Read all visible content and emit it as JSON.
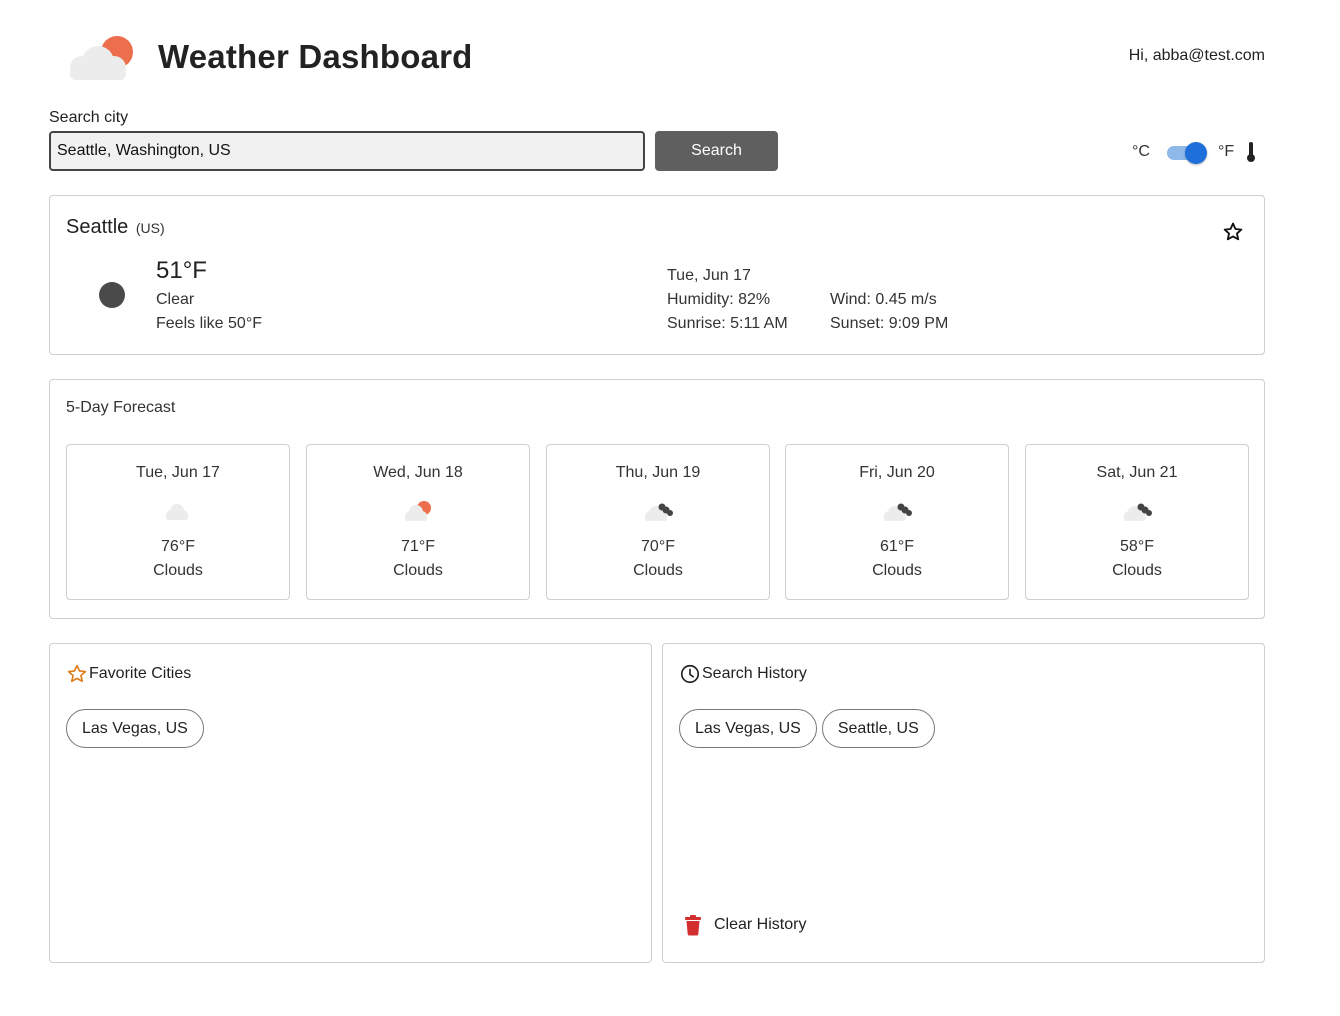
{
  "app": {
    "title": "Weather Dashboard",
    "greeting": "Hi, abba@test.com"
  },
  "search": {
    "label": "Search city",
    "value": "Seattle, Washington, US",
    "button_label": "Search"
  },
  "units": {
    "celsius_label": "°C",
    "fahrenheit_label": "°F",
    "selected": "F"
  },
  "current": {
    "city": "Seattle",
    "country": "(US)",
    "temperature": "51°F",
    "description": "Clear",
    "feels_like": "Feels like 50°F",
    "date": "Tue, Jun 17",
    "humidity": "Humidity: 82%",
    "wind": "Wind: 0.45 m/s",
    "sunrise": "Sunrise: 5:11 AM",
    "sunset": "Sunset: 9:09 PM",
    "icon": "clear-night-icon",
    "icon_color": "#4a4a4a"
  },
  "forecast": {
    "title": "5-Day Forecast",
    "days": [
      {
        "date": "Tue, Jun 17",
        "temp": "76°F",
        "desc": "Clouds",
        "icon": "few-clouds-icon"
      },
      {
        "date": "Wed, Jun 18",
        "temp": "71°F",
        "desc": "Clouds",
        "icon": "partly-cloudy-day-icon"
      },
      {
        "date": "Thu, Jun 19",
        "temp": "70°F",
        "desc": "Clouds",
        "icon": "broken-clouds-icon"
      },
      {
        "date": "Fri, Jun 20",
        "temp": "61°F",
        "desc": "Clouds",
        "icon": "broken-clouds-icon"
      },
      {
        "date": "Sat, Jun 21",
        "temp": "58°F",
        "desc": "Clouds",
        "icon": "broken-clouds-icon"
      }
    ]
  },
  "favorites": {
    "title": "Favorite Cities",
    "items": [
      "Las Vegas, US"
    ]
  },
  "history": {
    "title": "Search History",
    "items": [
      "Las Vegas, US",
      "Seattle, US"
    ],
    "clear_label": "Clear History"
  },
  "colors": {
    "accent": "#1e6fd9",
    "sun": "#ec6e4c",
    "star_orange": "#e07b1a",
    "trash_red": "#d32f2f",
    "button_gray": "#5f5f5f"
  }
}
